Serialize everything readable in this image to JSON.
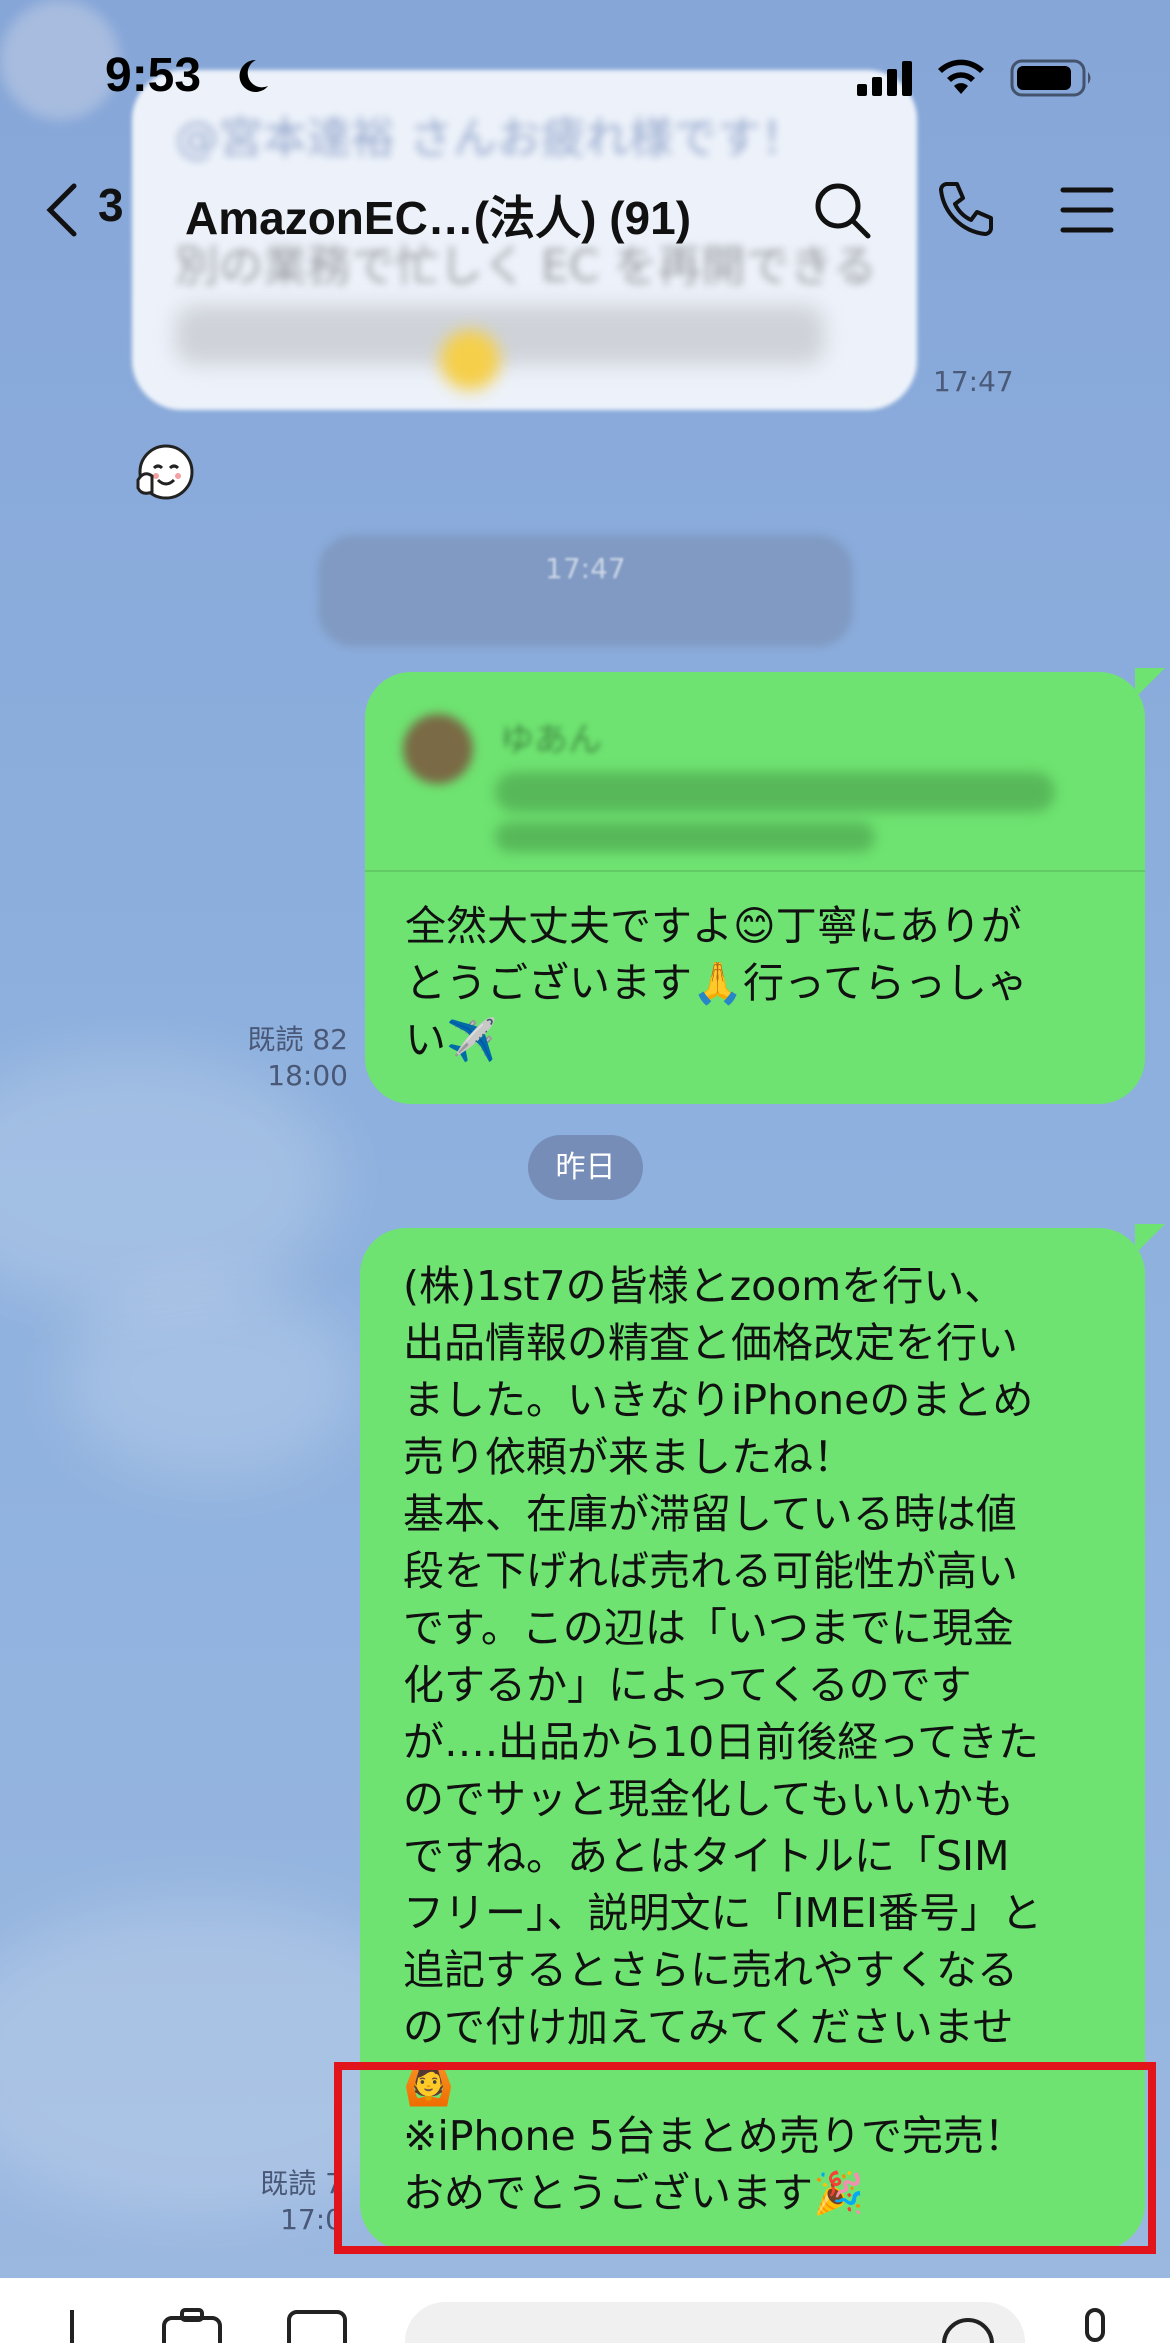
{
  "status_bar": {
    "time": "9:53"
  },
  "nav": {
    "back_count": "3",
    "title": "AmazonEC…(法人) (91)"
  },
  "received_message": {
    "preview_line_1": "@宮本達裕 さんお疲れ様です！",
    "preview_line_2": "別の業務で忙しく EC を再開できる",
    "time": "17:47"
  },
  "system_message": {
    "time": "17:47"
  },
  "sent_message_1": {
    "quote_name": "ゆあん",
    "text": "全然大丈夫ですよ😊丁寧にありが\nとうございます🙏行ってらっしゃ\nい✈️",
    "read_label": "既読 82",
    "time": "18:00"
  },
  "date_divider": "昨日",
  "sent_message_2": {
    "text": "(株)1st7の皆様とzoomを行い、\n出品情報の精査と価格改定を行い\nました。いきなりiPhoneのまとめ\n売り依頼が来ましたね！\n基本、在庫が滞留している時は値\n段を下げれば売れる可能性が高い\nです。この辺は「いつまでに現金\n化するか」によってくるのです\nが….出品から10日前後経ってきた\nのでサッと現金化してもいいかも\nですね。あとはタイトルに「SIM\nフリー」、説明文に「IMEI番号」と\n追記するとさらに売れやすくなる\nので付け加えてみてくださいませ\n🙆",
    "highlight_text": "※iPhone 5台まとめ売りで完売！\nおめでとうございます🎉",
    "read_label": "既読 7",
    "time": "17:0"
  },
  "colors": {
    "bubble_green": "#6ee371",
    "highlight_red": "#e0141a",
    "background": "#8eaddb"
  },
  "icons": [
    "moon-icon",
    "signal-icon",
    "wifi-icon",
    "battery-icon",
    "back-chevron-icon",
    "search-icon",
    "phone-icon",
    "menu-icon",
    "reaction-emoji-icon",
    "plus-icon",
    "camera-icon",
    "image-icon",
    "mic-icon"
  ]
}
